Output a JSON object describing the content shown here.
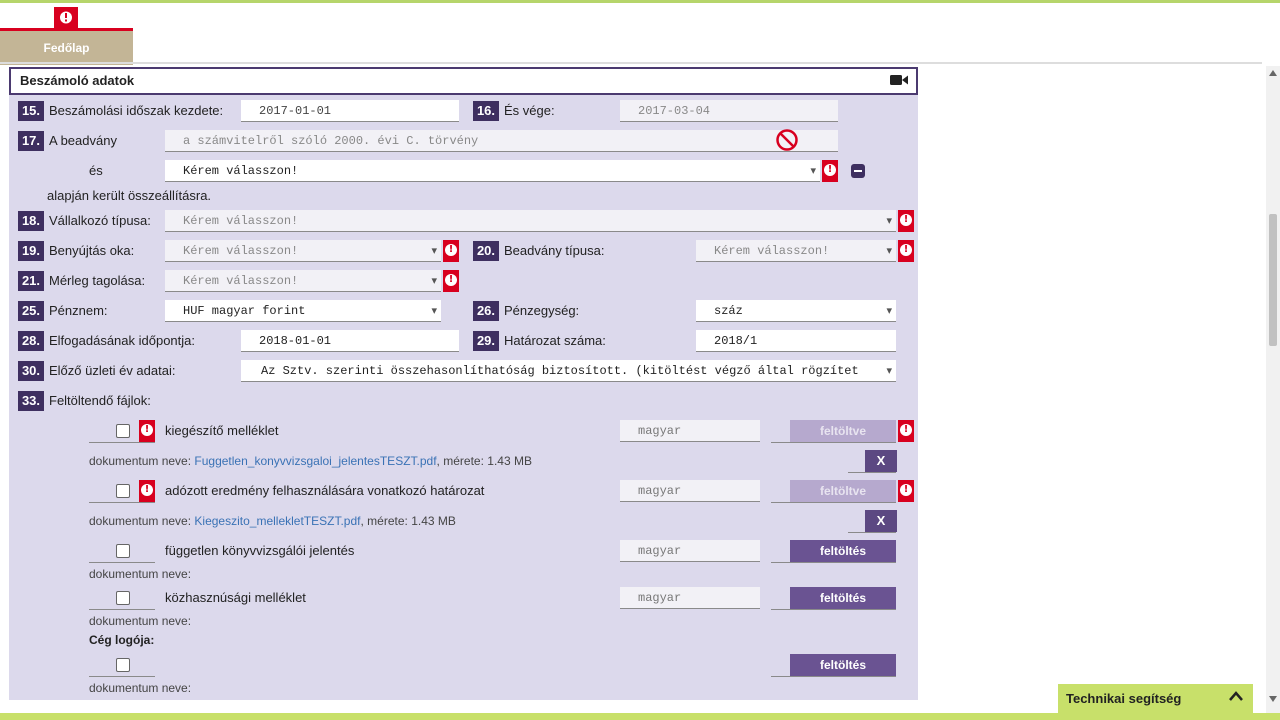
{
  "tab": {
    "label": "Fedőlap"
  },
  "panel": {
    "title": "Beszámoló adatok"
  },
  "rows": {
    "r15": {
      "num": "15.",
      "label": "Beszámolási időszak kezdete:",
      "value": "2017-01-01"
    },
    "r16": {
      "num": "16.",
      "label": "És vége:",
      "value": "2017-03-04"
    },
    "r17": {
      "num": "17.",
      "label": "A beadvány",
      "value": "a számvitelről szóló 2000. évi C. törvény",
      "and_label": "és",
      "and_value": "Kérem válasszon!",
      "tail": "alapján került összeállításra."
    },
    "r18": {
      "num": "18.",
      "label": "Vállalkozó típusa:",
      "value": "Kérem válasszon!"
    },
    "r19": {
      "num": "19.",
      "label": "Benyújtás oka:",
      "value": "Kérem válasszon!"
    },
    "r20": {
      "num": "20.",
      "label": "Beadvány típusa:",
      "value": "Kérem válasszon!"
    },
    "r21": {
      "num": "21.",
      "label": "Mérleg tagolása:",
      "value": "Kérem válasszon!"
    },
    "r25": {
      "num": "25.",
      "label": "Pénznem:",
      "value": "HUF magyar forint"
    },
    "r26": {
      "num": "26.",
      "label": "Pénzegység:",
      "value": "száz"
    },
    "r28": {
      "num": "28.",
      "label": "Elfogadásának időpontja:",
      "value": "2018-01-01"
    },
    "r29": {
      "num": "29.",
      "label": "Határozat száma:",
      "value": "2018/1"
    },
    "r30": {
      "num": "30.",
      "label": "Előző üzleti év adatai:",
      "value": "Az Sztv. szerinti összehasonlíthatóság biztosított. (kitöltést végző által rögzítet"
    },
    "r33": {
      "num": "33.",
      "label": "Feltöltendő fájlok:"
    }
  },
  "files": {
    "doc_label": "dokumentum neve:",
    "size_label": "mérete:",
    "lang": "magyar",
    "f1": {
      "name": "kiegészítő melléklet",
      "button": "feltöltve",
      "doc": "Fuggetlen_konyvvizsgaloi_jelentesTESZT.pdf",
      "size": "1.43 MB"
    },
    "f2": {
      "name": "adózott eredmény felhasználására vonatkozó határozat",
      "button": "feltöltve",
      "doc": "Kiegeszito_mellekletTESZT.pdf",
      "size": "1.43 MB"
    },
    "f3": {
      "name": "független könyvvizsgálói jelentés",
      "button": "feltöltés"
    },
    "f4": {
      "name": "közhasznúsági melléklet",
      "button": "feltöltés"
    },
    "logo": {
      "title": "Cég logója:",
      "button": "feltöltés"
    },
    "remove": "X"
  },
  "help": {
    "label": "Technikai segítség"
  },
  "colors": {
    "accent": "#3e2f60",
    "alert": "#d8001f",
    "panel": "#dcd9ec",
    "help": "#c8e06a"
  }
}
